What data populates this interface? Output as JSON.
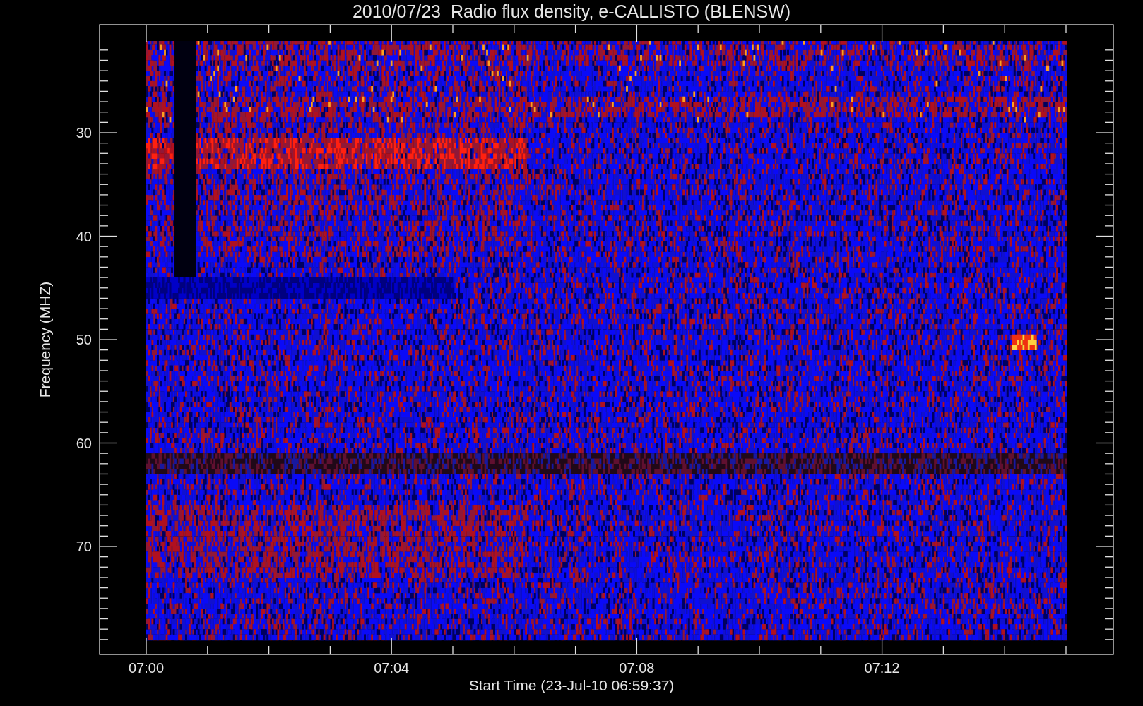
{
  "title": "2010/07/23  Radio flux density, e-CALLISTO (BLENSW)",
  "plot": {
    "x_axis": {
      "label": "Start Time (23-Jul-10 06:59:37)",
      "ticks": [
        "07:00",
        "07:04",
        "07:08",
        "07:12"
      ]
    },
    "y_axis": {
      "label": "Frequency (MHZ)",
      "ticks": [
        "30",
        "40",
        "50",
        "60",
        "70"
      ]
    }
  }
}
